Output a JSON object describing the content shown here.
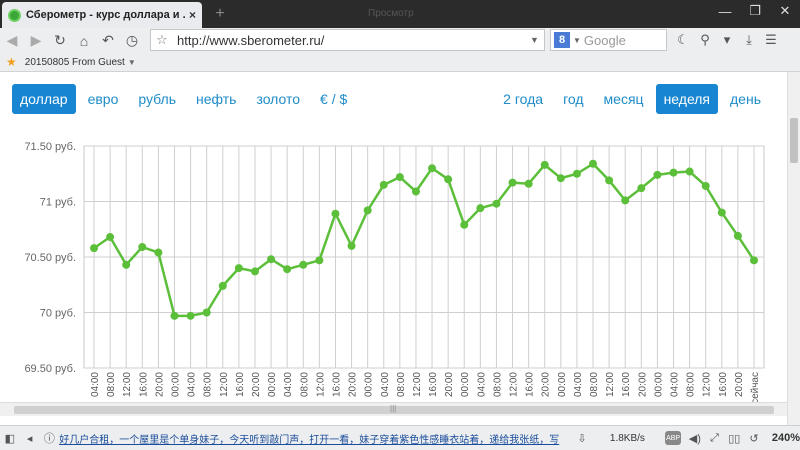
{
  "browser": {
    "tab_title": "Сберометр - курс доллара и ...",
    "tab_close": "×",
    "new_tab": "+",
    "ghost_tab": "Просмотр",
    "window_controls": [
      "—",
      "❐",
      "✕"
    ],
    "url": "http://www.sberometer.ru/",
    "search_placeholder": "Google",
    "search_engine_letter": "8",
    "bookmark_label": "20150805 From Guest",
    "news_ticker": "好几户合租，一个屋里是个单身妹子，今天听到敲门声，打开一看，妹子穿着紫色性感睡衣站着，递给我张纸，写",
    "net_speed": "1.8KB/s",
    "adblock_label": "ABP",
    "zoom_level": "240%",
    "icons": [
      "back-icon",
      "forward-icon",
      "reload-icon",
      "home-icon",
      "undo-icon",
      "history-icon",
      "bookmark-star-icon",
      "moon-icon",
      "download-icon",
      "menu-icon"
    ]
  },
  "filters": {
    "currency": [
      {
        "label": "доллар",
        "active": true
      },
      {
        "label": "евро",
        "active": false
      },
      {
        "label": "рубль",
        "active": false
      },
      {
        "label": "нефть",
        "active": false
      },
      {
        "label": "золото",
        "active": false
      },
      {
        "label": "€ / $",
        "active": false
      }
    ],
    "period": [
      {
        "label": "2 года",
        "active": false
      },
      {
        "label": "год",
        "active": false
      },
      {
        "label": "месяц",
        "active": false
      },
      {
        "label": "неделя",
        "active": true
      },
      {
        "label": "день",
        "active": false
      }
    ]
  },
  "chart_data": {
    "type": "line",
    "title": "",
    "xlabel": "",
    "ylabel": "",
    "ylim": [
      69.5,
      71.5
    ],
    "yticks": [
      {
        "value": 71.5,
        "label": "71.50 руб."
      },
      {
        "value": 71.0,
        "label": "71 руб."
      },
      {
        "value": 70.5,
        "label": "70.50 руб."
      },
      {
        "value": 70.0,
        "label": "70 руб."
      },
      {
        "value": 69.5,
        "label": "69.50 руб."
      }
    ],
    "grid": true,
    "line_color": "#5cbf3a",
    "categories": [
      "04:00",
      "08:00",
      "12:00",
      "16:00",
      "20:00",
      "00:00",
      "04:00",
      "08:00",
      "12:00",
      "16:00",
      "20:00",
      "00:00",
      "04:00",
      "08:00",
      "12:00",
      "16:00",
      "20:00",
      "00:00",
      "04:00",
      "08:00",
      "12:00",
      "16:00",
      "20:00",
      "00:00",
      "04:00",
      "08:00",
      "12:00",
      "16:00",
      "20:00",
      "00:00",
      "04:00",
      "08:00",
      "12:00",
      "16:00",
      "20:00",
      "00:00",
      "04:00",
      "08:00",
      "12:00",
      "16:00",
      "20:00",
      "сейчас"
    ],
    "series": [
      {
        "values": [
          70.58,
          70.68,
          70.43,
          70.59,
          70.54,
          69.97,
          69.97,
          70.0,
          70.24,
          70.4,
          70.37,
          70.48,
          70.39,
          70.43,
          70.47,
          70.89,
          70.6,
          70.92,
          71.15,
          71.22,
          71.09,
          71.3,
          71.2,
          70.79,
          70.94,
          70.98,
          71.17,
          71.16,
          71.33,
          71.21,
          71.25,
          71.34,
          71.19,
          71.01,
          71.12,
          71.24,
          71.26,
          71.27,
          71.14,
          70.9,
          70.69,
          70.47
        ]
      }
    ]
  }
}
